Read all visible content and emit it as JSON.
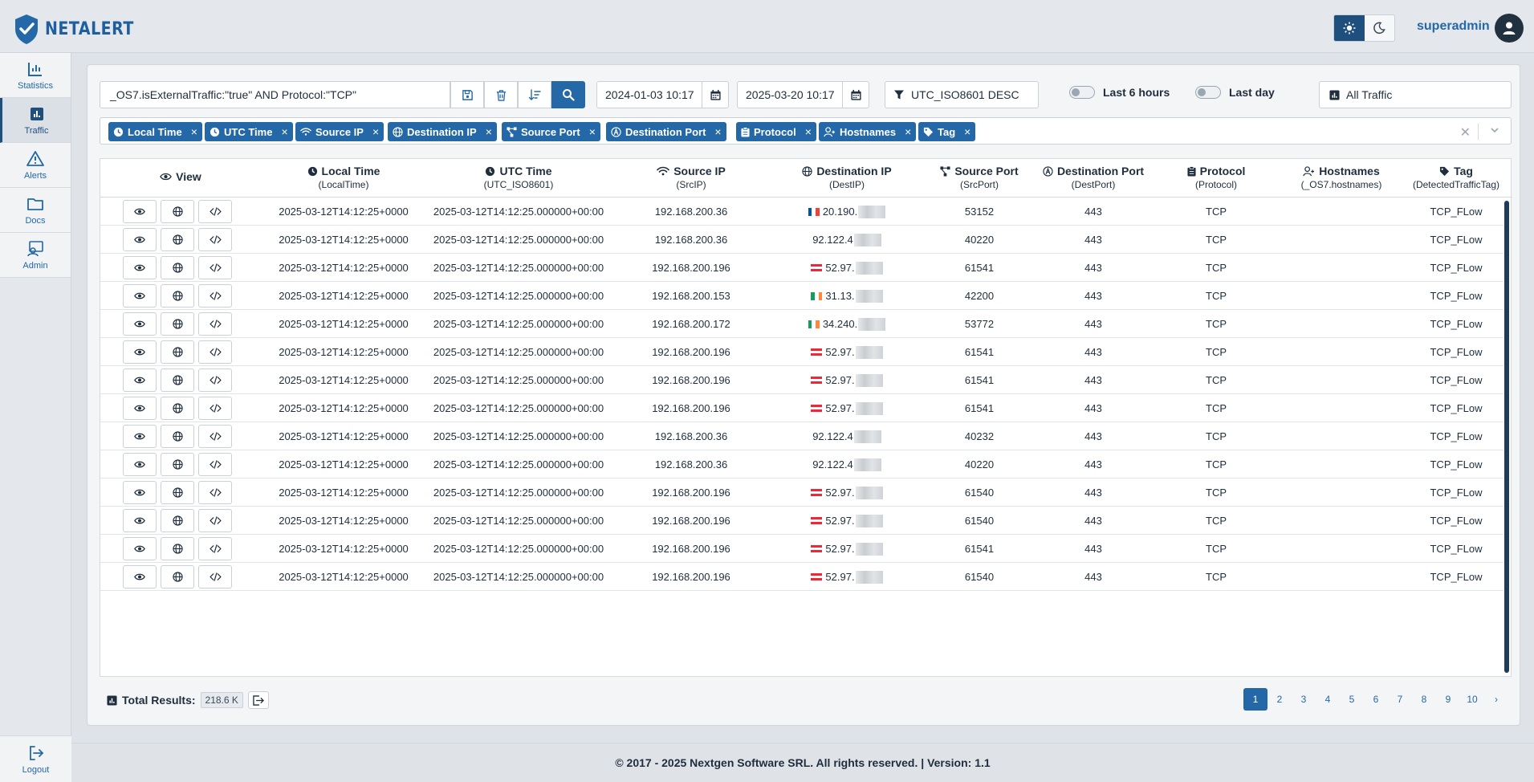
{
  "app": {
    "logo_text": "NETALERT"
  },
  "header": {
    "user_name": "superadmin"
  },
  "sidebar": {
    "items": [
      {
        "label": "Statistics",
        "icon": "chart-icon"
      },
      {
        "label": "Traffic",
        "icon": "bar-chart-icon",
        "active": true
      },
      {
        "label": "Alerts",
        "icon": "warning-icon"
      },
      {
        "label": "Docs",
        "icon": "folder-icon"
      },
      {
        "label": "Admin",
        "icon": "admin-icon"
      }
    ],
    "logout": "Logout"
  },
  "filters": {
    "query": "_OS7.isExternalTraffic:\"true\" AND Protocol:\"TCP\"",
    "date_from": "2024-01-03 10:17",
    "date_to": "2025-03-20 10:17",
    "sort": "UTC_ISO8601 DESC",
    "toggle_6h": "Last 6 hours",
    "toggle_day": "Last day",
    "traffic_select": "All Traffic"
  },
  "chips": [
    {
      "label": "Local Time",
      "icon": "clock-icon"
    },
    {
      "label": "UTC Time",
      "icon": "clock-icon"
    },
    {
      "label": "Source IP",
      "icon": "wifi-icon"
    },
    {
      "label": "Destination IP",
      "icon": "globe-icon"
    },
    {
      "label": "Source Port",
      "icon": "network-icon"
    },
    {
      "label": "Destination Port",
      "icon": "anchor-icon"
    },
    {
      "label": "Protocol",
      "icon": "clipboard-icon"
    },
    {
      "label": "Hostnames",
      "icon": "users-icon"
    },
    {
      "label": "Tag",
      "icon": "tag-icon"
    }
  ],
  "table": {
    "columns": [
      {
        "title": "View",
        "sub": ""
      },
      {
        "title": "Local Time",
        "sub": "(LocalTime)"
      },
      {
        "title": "UTC Time",
        "sub": "(UTC_ISO8601)"
      },
      {
        "title": "Source IP",
        "sub": "(SrcIP)"
      },
      {
        "title": "Destination IP",
        "sub": "(DestIP)"
      },
      {
        "title": "Source Port",
        "sub": "(SrcPort)"
      },
      {
        "title": "Destination Port",
        "sub": "(DestPort)"
      },
      {
        "title": "Protocol",
        "sub": "(Protocol)"
      },
      {
        "title": "Hostnames",
        "sub": "(_OS7.hostnames)"
      },
      {
        "title": "Tag",
        "sub": "(DetectedTrafficTag)"
      }
    ],
    "rows": [
      {
        "local": "2025-03-12T14:12:25+0000",
        "utc": "2025-03-12T14:12:25.000000+00:00",
        "src": "192.168.200.36",
        "flag": "fr",
        "dest": "20.190.",
        "sport": "53152",
        "dport": "443",
        "proto": "TCP",
        "host": "",
        "tag": "TCP_FLow"
      },
      {
        "local": "2025-03-12T14:12:25+0000",
        "utc": "2025-03-12T14:12:25.000000+00:00",
        "src": "192.168.200.36",
        "flag": "",
        "dest": "92.122.4",
        "sport": "40220",
        "dport": "443",
        "proto": "TCP",
        "host": "",
        "tag": "TCP_FLow"
      },
      {
        "local": "2025-03-12T14:12:25+0000",
        "utc": "2025-03-12T14:12:25.000000+00:00",
        "src": "192.168.200.196",
        "flag": "at",
        "dest": "52.97.",
        "sport": "61541",
        "dport": "443",
        "proto": "TCP",
        "host": "",
        "tag": "TCP_FLow"
      },
      {
        "local": "2025-03-12T14:12:25+0000",
        "utc": "2025-03-12T14:12:25.000000+00:00",
        "src": "192.168.200.153",
        "flag": "ie",
        "dest": "31.13.",
        "sport": "42200",
        "dport": "443",
        "proto": "TCP",
        "host": "",
        "tag": "TCP_FLow"
      },
      {
        "local": "2025-03-12T14:12:25+0000",
        "utc": "2025-03-12T14:12:25.000000+00:00",
        "src": "192.168.200.172",
        "flag": "ie",
        "dest": "34.240.",
        "sport": "53772",
        "dport": "443",
        "proto": "TCP",
        "host": "",
        "tag": "TCP_FLow"
      },
      {
        "local": "2025-03-12T14:12:25+0000",
        "utc": "2025-03-12T14:12:25.000000+00:00",
        "src": "192.168.200.196",
        "flag": "at",
        "dest": "52.97.",
        "sport": "61541",
        "dport": "443",
        "proto": "TCP",
        "host": "",
        "tag": "TCP_FLow"
      },
      {
        "local": "2025-03-12T14:12:25+0000",
        "utc": "2025-03-12T14:12:25.000000+00:00",
        "src": "192.168.200.196",
        "flag": "at",
        "dest": "52.97.",
        "sport": "61541",
        "dport": "443",
        "proto": "TCP",
        "host": "",
        "tag": "TCP_FLow"
      },
      {
        "local": "2025-03-12T14:12:25+0000",
        "utc": "2025-03-12T14:12:25.000000+00:00",
        "src": "192.168.200.196",
        "flag": "at",
        "dest": "52.97.",
        "sport": "61541",
        "dport": "443",
        "proto": "TCP",
        "host": "",
        "tag": "TCP_FLow"
      },
      {
        "local": "2025-03-12T14:12:25+0000",
        "utc": "2025-03-12T14:12:25.000000+00:00",
        "src": "192.168.200.36",
        "flag": "",
        "dest": "92.122.4",
        "sport": "40232",
        "dport": "443",
        "proto": "TCP",
        "host": "",
        "tag": "TCP_FLow"
      },
      {
        "local": "2025-03-12T14:12:25+0000",
        "utc": "2025-03-12T14:12:25.000000+00:00",
        "src": "192.168.200.36",
        "flag": "",
        "dest": "92.122.4",
        "sport": "40220",
        "dport": "443",
        "proto": "TCP",
        "host": "",
        "tag": "TCP_FLow"
      },
      {
        "local": "2025-03-12T14:12:25+0000",
        "utc": "2025-03-12T14:12:25.000000+00:00",
        "src": "192.168.200.196",
        "flag": "at",
        "dest": "52.97.",
        "sport": "61540",
        "dport": "443",
        "proto": "TCP",
        "host": "",
        "tag": "TCP_FLow"
      },
      {
        "local": "2025-03-12T14:12:25+0000",
        "utc": "2025-03-12T14:12:25.000000+00:00",
        "src": "192.168.200.196",
        "flag": "at",
        "dest": "52.97.",
        "sport": "61540",
        "dport": "443",
        "proto": "TCP",
        "host": "",
        "tag": "TCP_FLow"
      },
      {
        "local": "2025-03-12T14:12:25+0000",
        "utc": "2025-03-12T14:12:25.000000+00:00",
        "src": "192.168.200.196",
        "flag": "at",
        "dest": "52.97.",
        "sport": "61541",
        "dport": "443",
        "proto": "TCP",
        "host": "",
        "tag": "TCP_FLow"
      },
      {
        "local": "2025-03-12T14:12:25+0000",
        "utc": "2025-03-12T14:12:25.000000+00:00",
        "src": "192.168.200.196",
        "flag": "at",
        "dest": "52.97.",
        "sport": "61540",
        "dport": "443",
        "proto": "TCP",
        "host": "",
        "tag": "TCP_FLow"
      }
    ]
  },
  "summary": {
    "total_label": "Total Results:",
    "total_value": "218.6 K"
  },
  "pagination": {
    "pages": [
      "1",
      "2",
      "3",
      "4",
      "5",
      "6",
      "7",
      "8",
      "9",
      "10"
    ],
    "next": "›",
    "current": "1"
  },
  "footer": {
    "text": "© 2017 - 2025 Nextgen Software SRL. All rights reserved. | Version: 1.1"
  },
  "colors": {
    "accent": "#2468a8",
    "dark_accent": "#1f4f7d",
    "background": "#dfe3e8"
  }
}
